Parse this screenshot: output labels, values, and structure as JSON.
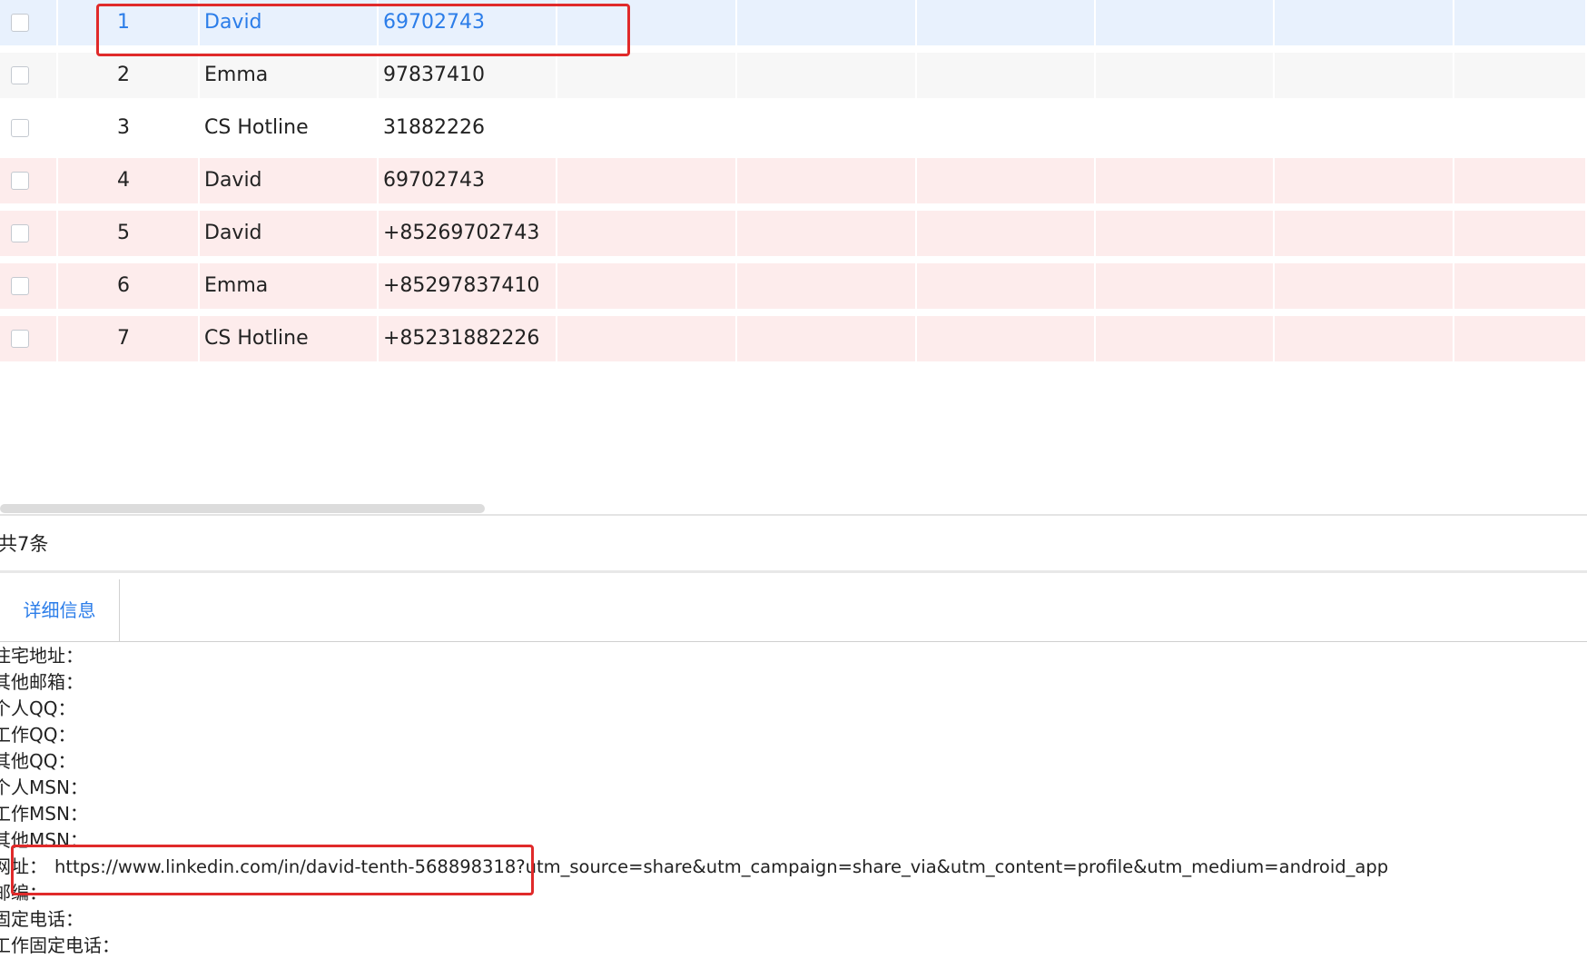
{
  "table": {
    "rows": [
      {
        "index": "1",
        "name": "David",
        "phone": "69702743",
        "state": "selected"
      },
      {
        "index": "2",
        "name": "Emma",
        "phone": "97837410",
        "state": "striped"
      },
      {
        "index": "3",
        "name": "CS Hotline",
        "phone": "31882226",
        "state": "plain"
      },
      {
        "index": "4",
        "name": "David",
        "phone": "69702743",
        "state": "warn"
      },
      {
        "index": "5",
        "name": "David",
        "phone": "+85269702743",
        "state": "warn"
      },
      {
        "index": "6",
        "name": "Emma",
        "phone": "+85297837410",
        "state": "warn"
      },
      {
        "index": "7",
        "name": "CS Hotline",
        "phone": "+85231882226",
        "state": "warn"
      }
    ]
  },
  "footer": {
    "total_label": "共7条"
  },
  "tabs": [
    {
      "label": "详细信息",
      "active": true
    }
  ],
  "details": [
    {
      "label": "住宅地址：",
      "value": ""
    },
    {
      "label": "其他邮箱：",
      "value": ""
    },
    {
      "label": "个人QQ：",
      "value": ""
    },
    {
      "label": "工作QQ：",
      "value": ""
    },
    {
      "label": "其他QQ：",
      "value": ""
    },
    {
      "label": "个人MSN：",
      "value": ""
    },
    {
      "label": "工作MSN：",
      "value": ""
    },
    {
      "label": "其他MSN：",
      "value": ""
    },
    {
      "label": "网址：",
      "value": "https://www.linkedin.com/in/david-tenth-568898318?utm_source=share&utm_campaign=share_via&utm_content=profile&utm_medium=android_app"
    },
    {
      "label": "邮编：",
      "value": ""
    },
    {
      "label": "固定电话：",
      "value": ""
    },
    {
      "label": "工作固定电话：",
      "value": ""
    }
  ],
  "colors": {
    "accent": "#2b7de9",
    "selected_row": "#e8f1fd",
    "warn_row": "#fdecec",
    "highlight_box": "#e02a2a"
  }
}
